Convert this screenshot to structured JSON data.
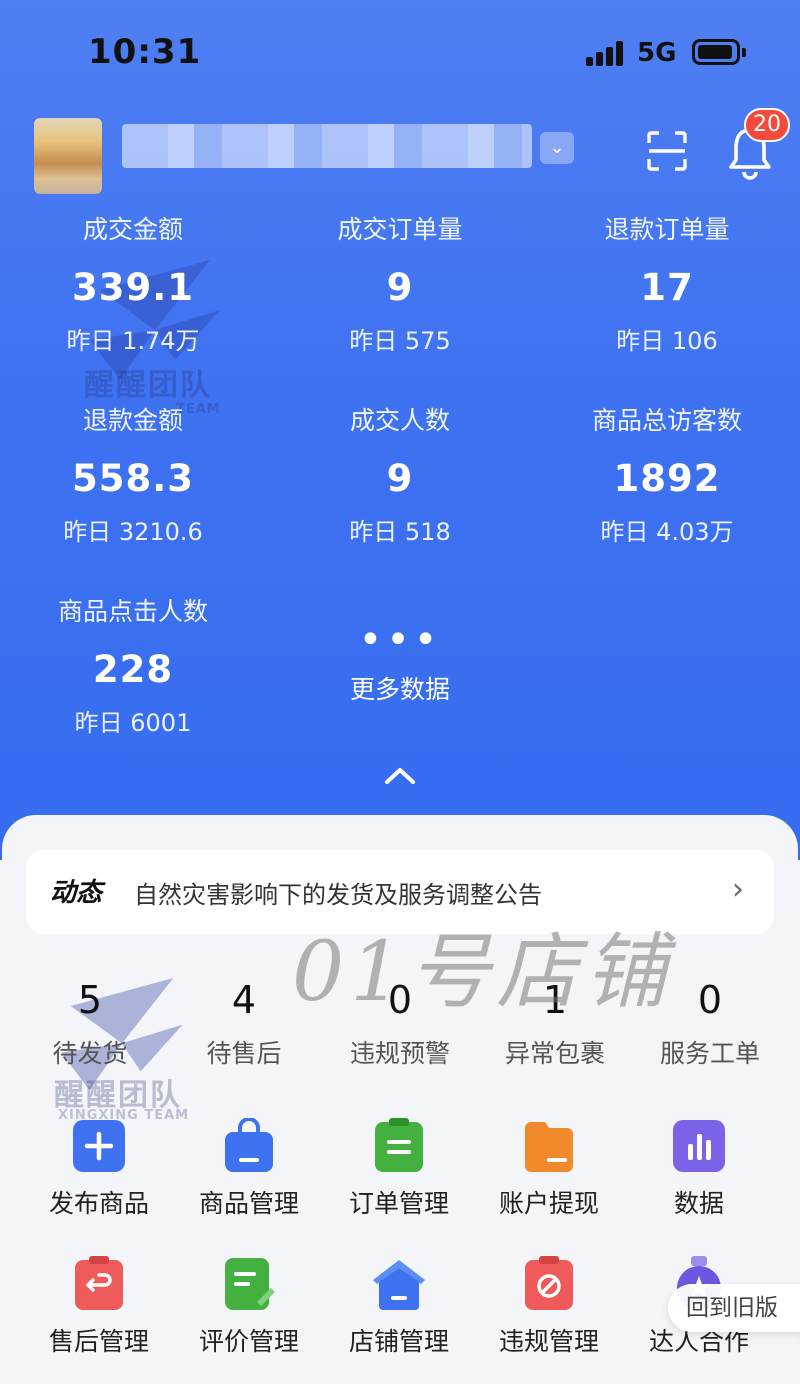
{
  "status_bar": {
    "time": "10:31",
    "network": "5G"
  },
  "header": {
    "notification_count": "20"
  },
  "stats": [
    {
      "label": "成交金额",
      "value": "339.1",
      "sub": "昨日 1.74万"
    },
    {
      "label": "成交订单量",
      "value": "9",
      "sub": "昨日 575"
    },
    {
      "label": "退款订单量",
      "value": "17",
      "sub": "昨日 106"
    },
    {
      "label": "退款金额",
      "value": "558.3",
      "sub": "昨日 3210.6"
    },
    {
      "label": "成交人数",
      "value": "9",
      "sub": "昨日 518"
    },
    {
      "label": "商品总访客数",
      "value": "1892",
      "sub": "昨日 4.03万"
    },
    {
      "label": "商品点击人数",
      "value": "228",
      "sub": "昨日 6001"
    }
  ],
  "more": {
    "dots": "•••",
    "label": "更多数据"
  },
  "watermark": {
    "brand": "醒醒团队",
    "brand_en": "XINGXING TEAM",
    "brand_en_short": "TEAM"
  },
  "notice": {
    "tag": "动态",
    "text": "自然灾害影响下的发货及服务调整公告"
  },
  "overlay": {
    "shop": "01号店铺"
  },
  "counters": [
    {
      "value": "5",
      "label": "待发货"
    },
    {
      "value": "4",
      "label": "待售后"
    },
    {
      "value": "0",
      "label": "违规预警"
    },
    {
      "value": "1",
      "label": "异常包裹"
    },
    {
      "value": "0",
      "label": "服务工单"
    }
  ],
  "tools": [
    {
      "label": "发布商品",
      "icon": "plus-icon",
      "color": "#3f72f1"
    },
    {
      "label": "商品管理",
      "icon": "shopping-bag-icon",
      "color": "#3f72f1"
    },
    {
      "label": "订单管理",
      "icon": "order-list-icon",
      "color": "#43b03f"
    },
    {
      "label": "账户提现",
      "icon": "wallet-icon",
      "color": "#f08a2c"
    },
    {
      "label": "数据",
      "icon": "bar-chart-icon",
      "color": "#7b62e6"
    },
    {
      "label": "售后管理",
      "icon": "after-sale-icon",
      "color": "#ef5b5b"
    },
    {
      "label": "评价管理",
      "icon": "review-icon",
      "color": "#43b03f"
    },
    {
      "label": "店铺管理",
      "icon": "store-icon",
      "color": "#3f72f1"
    },
    {
      "label": "违规管理",
      "icon": "violation-icon",
      "color": "#ef5b5b"
    },
    {
      "label": "达人合作",
      "icon": "influencer-icon",
      "color": "#6a58e0"
    }
  ],
  "floating": {
    "old_version": "回到旧版"
  }
}
